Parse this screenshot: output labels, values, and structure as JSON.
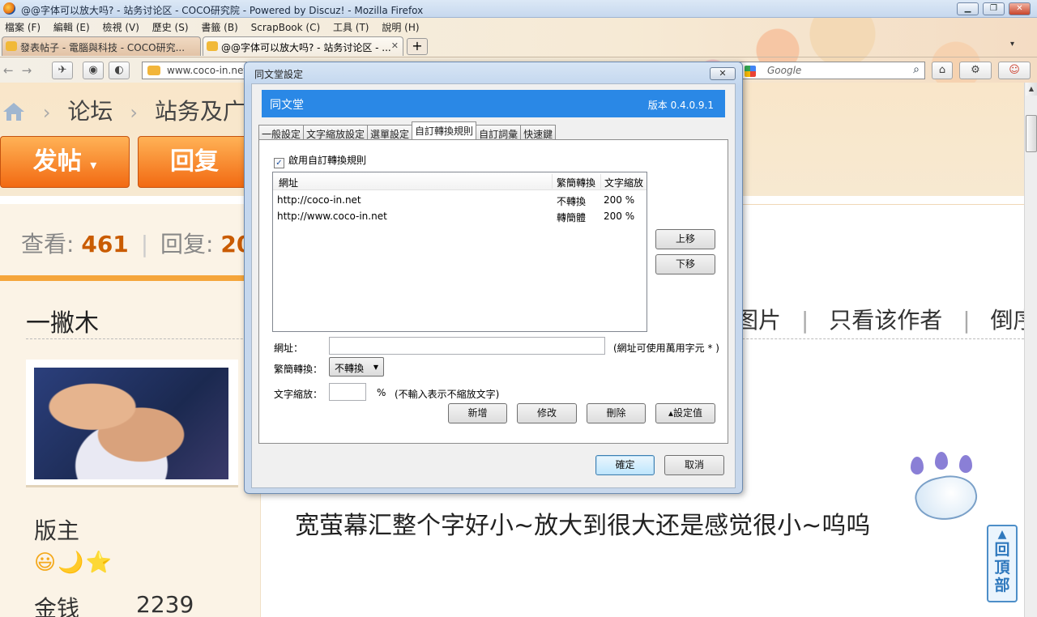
{
  "window": {
    "title": "@@字体可以放大吗? - 站务讨论区 - COCO研究院 - Powered by Discuz! - Mozilla Firefox",
    "controls": {
      "minimize": "▁",
      "maximize": "❐",
      "close": "✕"
    }
  },
  "menu": [
    "檔案 (F)",
    "編輯 (E)",
    "檢視 (V)",
    "歷史 (S)",
    "書籤 (B)",
    "ScrapBook (C)",
    "工具 (T)",
    "說明 (H)"
  ],
  "tabs": [
    {
      "label": "發表帖子 - 電腦與科技 - COCO研究...",
      "active": false
    },
    {
      "label": "@@字体可以放大吗? - 站务讨论区 - ...",
      "active": true,
      "close": "✕"
    }
  ],
  "newtab": "+",
  "tab_overflow": "▾",
  "nav": {
    "url": "www.coco-in.net",
    "search_placeholder": "Google",
    "back_forward": "←→"
  },
  "forum": {
    "breadcrumb": [
      "论坛",
      "站务及广告"
    ],
    "breadcrumb_sep": "›",
    "post_button": "发帖",
    "post_button_arrow": "▾",
    "reply_button": "回复",
    "stats": {
      "views_label": "查看:",
      "views": "461",
      "sep": "|",
      "replies_label": "回复:",
      "replies": "20"
    },
    "author": "一撇木",
    "author_tools": [
      "图片",
      "只看该作者",
      "倒序浏"
    ],
    "author_tools_sep": "|",
    "rank": "版主",
    "rank_icons": "😃🌙⭐",
    "money_label": "金钱",
    "money_value": "2239",
    "post_text": "宽萤幕汇整个字好小~放大到很大还是感觉很小~呜呜",
    "back_to_top": {
      "arrow": "▲",
      "chars": [
        "回",
        "頂",
        "部"
      ]
    }
  },
  "dialog": {
    "title": "同文堂設定",
    "close": "✕",
    "app_name": "同文堂",
    "version": "版本 0.4.0.9.1",
    "tabs": [
      "一般設定",
      "文字縮放設定",
      "選單設定",
      "自訂轉換規則",
      "自訂詞彙",
      "快速鍵"
    ],
    "active_tab": 3,
    "enable_label": "啟用自訂轉換規則",
    "enable_checked": "✓",
    "columns": {
      "url": "網址",
      "conversion": "繁簡轉換",
      "zoom": "文字縮放"
    },
    "rows": [
      {
        "url": "http://coco-in.net",
        "conversion": "不轉換",
        "zoom": "200 %"
      },
      {
        "url": "http://www.coco-in.net",
        "conversion": "轉簡體",
        "zoom": "200 %"
      }
    ],
    "move_up": "上移",
    "move_down": "下移",
    "url_label": "網址：",
    "url_value": "",
    "url_hint": "(網址可使用萬用字元 * )",
    "conv_label": "繁簡轉換：",
    "conv_value": "不轉換",
    "conv_arrow": "▼",
    "zoom_label": "文字縮放：",
    "zoom_value": "",
    "zoom_unit": "%",
    "zoom_hint": "(不輸入表示不縮放文字)",
    "add": "新增",
    "edit": "修改",
    "delete": "刪除",
    "set_value": "▴設定值",
    "ok": "確定",
    "cancel": "取消"
  }
}
